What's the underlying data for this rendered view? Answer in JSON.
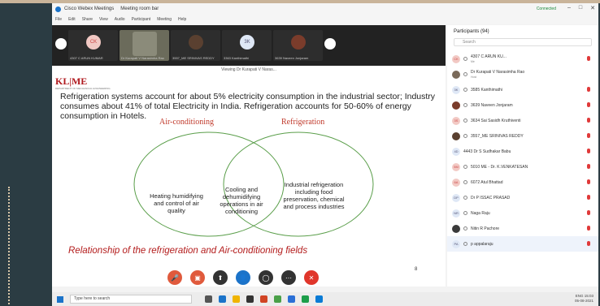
{
  "window": {
    "title": "Cisco Webex Meetings",
    "subtitle": "Meeting room bar",
    "status": "Connected",
    "controls": [
      "–",
      "□",
      "✕"
    ]
  },
  "menu": [
    "File",
    "Edit",
    "Share",
    "View",
    "Audio",
    "Participant",
    "Meeting",
    "Help"
  ],
  "thumbnails": [
    {
      "name": "4307 C ARUN KUMAR",
      "initials": "CK",
      "color": "#f2c9c4"
    },
    {
      "name": "Dr Kurapati V Narasimha Rao",
      "initials": "",
      "color": "#8b8b7a",
      "active": true
    },
    {
      "name": "3557_ME SRINIVAS REDDY",
      "initials": "",
      "color": "#5a4030"
    },
    {
      "name": "3363 Kanthimathi",
      "initials": "3K",
      "color": "#dfe8f6"
    },
    {
      "name": "3639 Naveen Jonjaram",
      "initials": "",
      "color": "#7a3c2b"
    }
  ],
  "share_notice": "Viewing Dr Kurapati V Naras...",
  "slide": {
    "logo": "KL|ME",
    "dept": "DEPARTMENT OF MECHANICAL ENGINEERING",
    "paragraph": "Refrigeration systems account for about 5% electricity consumption in the industrial sector; Industry consumes about 41% of total Electricity in India. Refrigeration accounts for 50-60% of energy consumption in Hotels.",
    "label_ac": "Air-conditioning",
    "label_refrig": "Refrigeration",
    "left_text": "Heating humidifying and control of air quality",
    "middle_text": "Cooling and dehumidifying operations in air conditioning",
    "right_text": "Industrial refrigeration including food preservation, chemical and process industries",
    "caption": "Relationship of the refrigeration and Air-conditioning fields",
    "page_number": "8"
  },
  "participants": {
    "header": "Participants (94)",
    "search_placeholder": "Search",
    "list": [
      {
        "name": "4307 C ARUN KU...",
        "sub": "Me",
        "avatar": "CK"
      },
      {
        "name": "Dr Kurapati V Narasimha Rao",
        "sub": "Host",
        "avatar": ""
      },
      {
        "name": "3585 Kanthimathi",
        "sub": "",
        "avatar": "3K"
      },
      {
        "name": "3639 Naveen Jonjaram",
        "sub": "",
        "avatar": ""
      },
      {
        "name": "3634 Sai Sasidh Kruthiventi",
        "sub": "",
        "avatar": "3S"
      },
      {
        "name": "3557_ME SRINIVAS REDDY",
        "sub": "",
        "avatar": ""
      },
      {
        "name": "4443 Dr S Sudhakar Babu",
        "sub": "",
        "avatar": "4D"
      },
      {
        "name": "5010 ME - Dr. K.VENKATESAN",
        "sub": "",
        "avatar": "5M"
      },
      {
        "name": "6072 Atul Bhattad",
        "sub": "",
        "avatar": "6A"
      },
      {
        "name": "Dr P ISSAC PRASAD",
        "sub": "",
        "avatar": "DP"
      },
      {
        "name": "Naga Raju",
        "sub": "",
        "avatar": "NR"
      },
      {
        "name": "Nitin R Pachore",
        "sub": "",
        "avatar": ""
      },
      {
        "name": "p appalaraju",
        "sub": "",
        "avatar": "PA"
      }
    ]
  },
  "taskbar": {
    "search_placeholder": "Type here to search",
    "time": "15:03",
    "date": "05-08-2021",
    "lang": "ENG"
  }
}
